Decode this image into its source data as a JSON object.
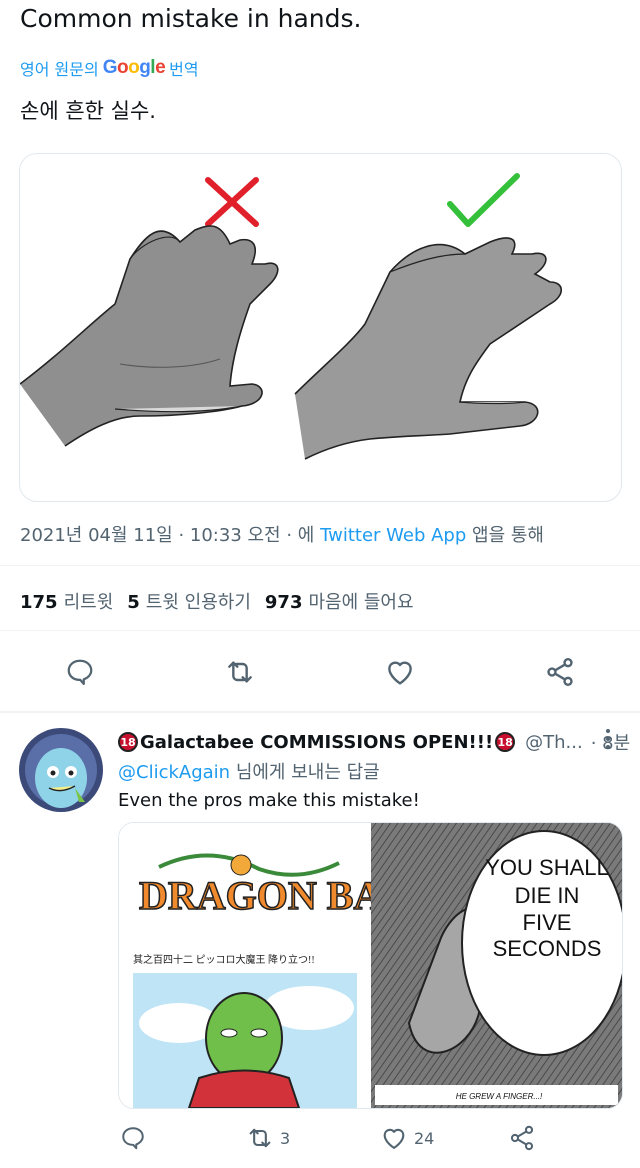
{
  "tweet": {
    "text": "Common mistake in hands.",
    "translate_prefix": "영어 원문의",
    "translate_brand": "Google",
    "translate_suffix": "번역",
    "translated_text": "손에 흔한 실수.",
    "timestamp": "2021년 04월 11일 · 10:33 오전 · 에",
    "source": "Twitter Web App",
    "source_suffix": "앱을 통해"
  },
  "stats": {
    "retweets_count": "175",
    "retweets_label": "리트윗",
    "quotes_count": "5",
    "quotes_label": "트윗 인용하기",
    "likes_count": "973",
    "likes_label": "마음에 들어요"
  },
  "reply": {
    "name": "Galactabee COMMISSIONS OPEN!!!",
    "badge": "18",
    "handle": "@Th...",
    "time": "· 8분",
    "replying_handle": "@ClickAgain",
    "replying_suffix": "님에게 보내는 답글",
    "text": "Even the pros make this mistake!",
    "retweet_count": "3",
    "like_count": "24"
  },
  "manga": {
    "speech": [
      "YOU SHALL",
      "DIE IN",
      "FIVE",
      "SECONDS"
    ],
    "caption": "HE GREW A FINGER...!",
    "logo": "DRAGON BALL",
    "subtitle": "其之百四十二 ピッコロ大魔王 降り立つ!!"
  },
  "colors": {
    "accent": "#1d9bf0",
    "wrong": "#e0202b",
    "right": "#34c03a",
    "muted": "#536471"
  },
  "icons": [
    "reply-icon",
    "retweet-icon",
    "like-icon",
    "share-icon",
    "more-icon"
  ]
}
